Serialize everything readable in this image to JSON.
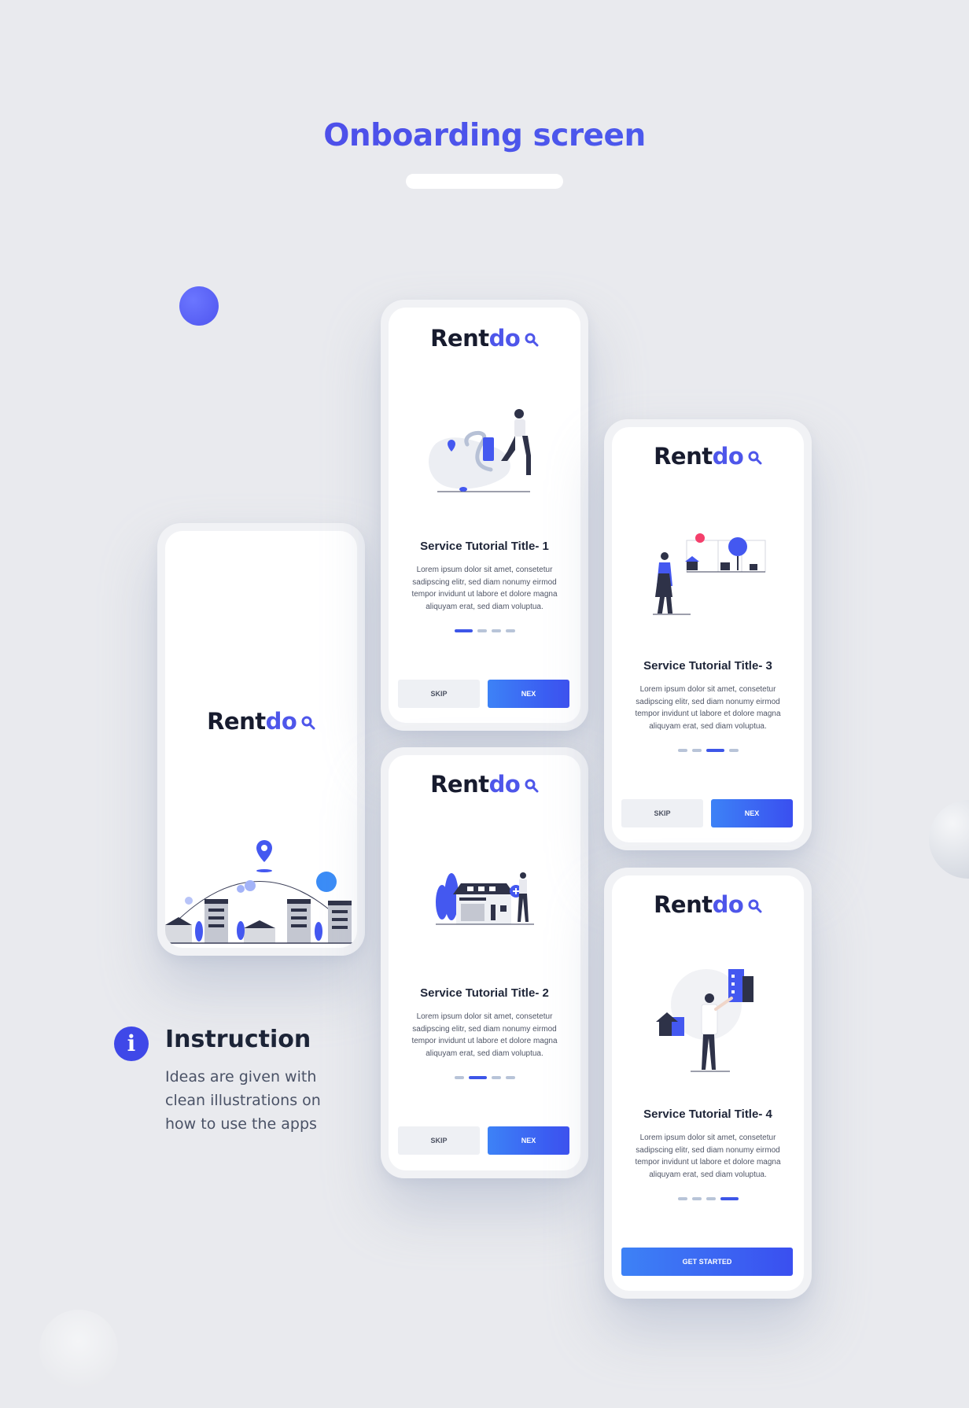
{
  "header": {
    "title": "Onboarding screen"
  },
  "brand": {
    "logo_main": "Rent",
    "logo_accent": "do"
  },
  "slide_1": {
    "title": "Service Tutorial Title- 1",
    "description": "Lorem ipsum dolor sit amet, consetetur sadipscing elitr, sed diam nonumy eirmod tempor invidunt ut labore et dolore magna aliquyam erat, sed diam voluptua.",
    "skip_label": "SKIP",
    "next_label": "NEX"
  },
  "slide_2": {
    "title": "Service Tutorial Title- 2",
    "description": "Lorem ipsum dolor sit amet, consetetur sadipscing elitr, sed diam nonumy eirmod tempor invidunt ut labore et dolore magna aliquyam erat, sed diam voluptua.",
    "skip_label": "SKIP",
    "next_label": "NEX"
  },
  "slide_3": {
    "title": "Service Tutorial Title- 3",
    "description": "Lorem ipsum dolor sit amet, consetetur sadipscing elitr, sed diam nonumy eirmod tempor invidunt ut labore et dolore magna aliquyam erat, sed diam voluptua.",
    "skip_label": "SKIP",
    "next_label": "NEX"
  },
  "slide_4": {
    "title": "Service Tutorial Title- 4",
    "description": "Lorem ipsum dolor sit amet, consetetur sadipscing elitr, sed diam nonumy eirmod tempor invidunt ut labore et dolore magna aliquyam erat, sed diam voluptua.",
    "start_label": "GET STARTED"
  },
  "instruction": {
    "title": "Instruction",
    "text": "Ideas are given with clean illustrations on how to use the apps"
  },
  "colors": {
    "accent": "#4e56ea",
    "button_gradient_start": "#3d82f6",
    "button_gradient_end": "#3a4ff0",
    "background": "#e9eaee"
  }
}
